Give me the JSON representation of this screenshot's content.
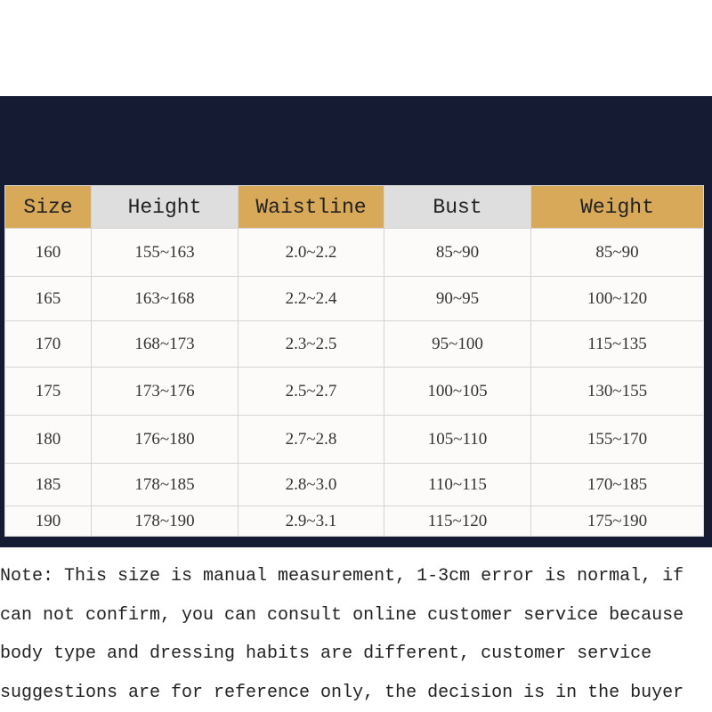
{
  "table": {
    "headers": [
      "Size",
      "Height",
      "Waistline",
      "Bust",
      "Weight"
    ],
    "rows": [
      [
        "160",
        "155~163",
        "2.0~2.2",
        "85~90",
        "85~90"
      ],
      [
        "165",
        "163~168",
        "2.2~2.4",
        "90~95",
        "100~120"
      ],
      [
        "170",
        "168~173",
        "2.3~2.5",
        "95~100",
        "115~135"
      ],
      [
        "175",
        "173~176",
        "2.5~2.7",
        "100~105",
        "130~155"
      ],
      [
        "180",
        "176~180",
        "2.7~2.8",
        "105~110",
        "155~170"
      ],
      [
        "185",
        "178~185",
        "2.8~3.0",
        "110~115",
        "170~185"
      ],
      [
        "190",
        "178~190",
        "2.9~3.1",
        "115~120",
        "175~190"
      ]
    ]
  },
  "note": {
    "lines": [
      "Note: This size is manual measurement, 1-3cm error is normal, if",
      "can not confirm, you can consult online customer service because",
      "body type and dressing habits are different, customer service",
      "suggestions are for reference only, the decision is in the buyer"
    ]
  },
  "colors": {
    "band": "#141b33",
    "header_gold": "#d9a95a",
    "header_grey": "#dedede"
  }
}
